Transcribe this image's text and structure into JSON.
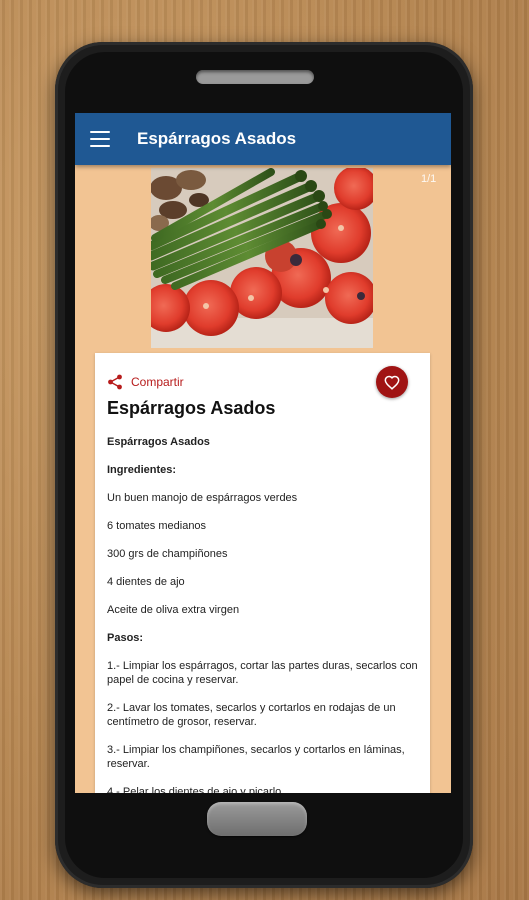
{
  "appbar": {
    "title": "Espárragos Asados",
    "menu_icon": "hamburger-menu-icon",
    "color": "#1f5893"
  },
  "gallery": {
    "page_indicator": "1/1",
    "image": "roasted-asparagus-tomatoes-mushrooms-photo"
  },
  "card": {
    "share_label": "Compartir",
    "share_icon": "share-icon",
    "favorite_icon": "heart-outline-icon",
    "accent_color": "#a01414",
    "title": "Espárragos Asados"
  },
  "recipe": {
    "paragraphs": [
      {
        "text": "Espárragos Asados",
        "bold": true
      },
      {
        "text": "Ingredientes:",
        "bold": true
      },
      {
        "text": "Un buen manojo de espárragos verdes",
        "bold": false
      },
      {
        "text": "6 tomates medianos",
        "bold": false
      },
      {
        "text": "300 grs de champiñones",
        "bold": false
      },
      {
        "text": "4 dientes de ajo",
        "bold": false
      },
      {
        "text": "Aceite de oliva extra virgen",
        "bold": false
      },
      {
        "text": "Pasos:",
        "bold": true
      },
      {
        "text": "1.- Limpiar los espárragos, cortar las partes duras, secarlos con papel de cocina y reservar.",
        "bold": false
      },
      {
        "text": "2.- Lavar los tomates, secarlos y cortarlos en rodajas de un centímetro de grosor, reservar.",
        "bold": false
      },
      {
        "text": "3.- Limpiar los champiñones, secarlos y cortarlos en láminas, reservar.",
        "bold": false
      },
      {
        "text": "4.- Pelar los dientes de ajo y picarlo",
        "bold": false
      }
    ]
  },
  "colors": {
    "screen_bg": "#f2c493",
    "share_text": "#b71c1c"
  }
}
